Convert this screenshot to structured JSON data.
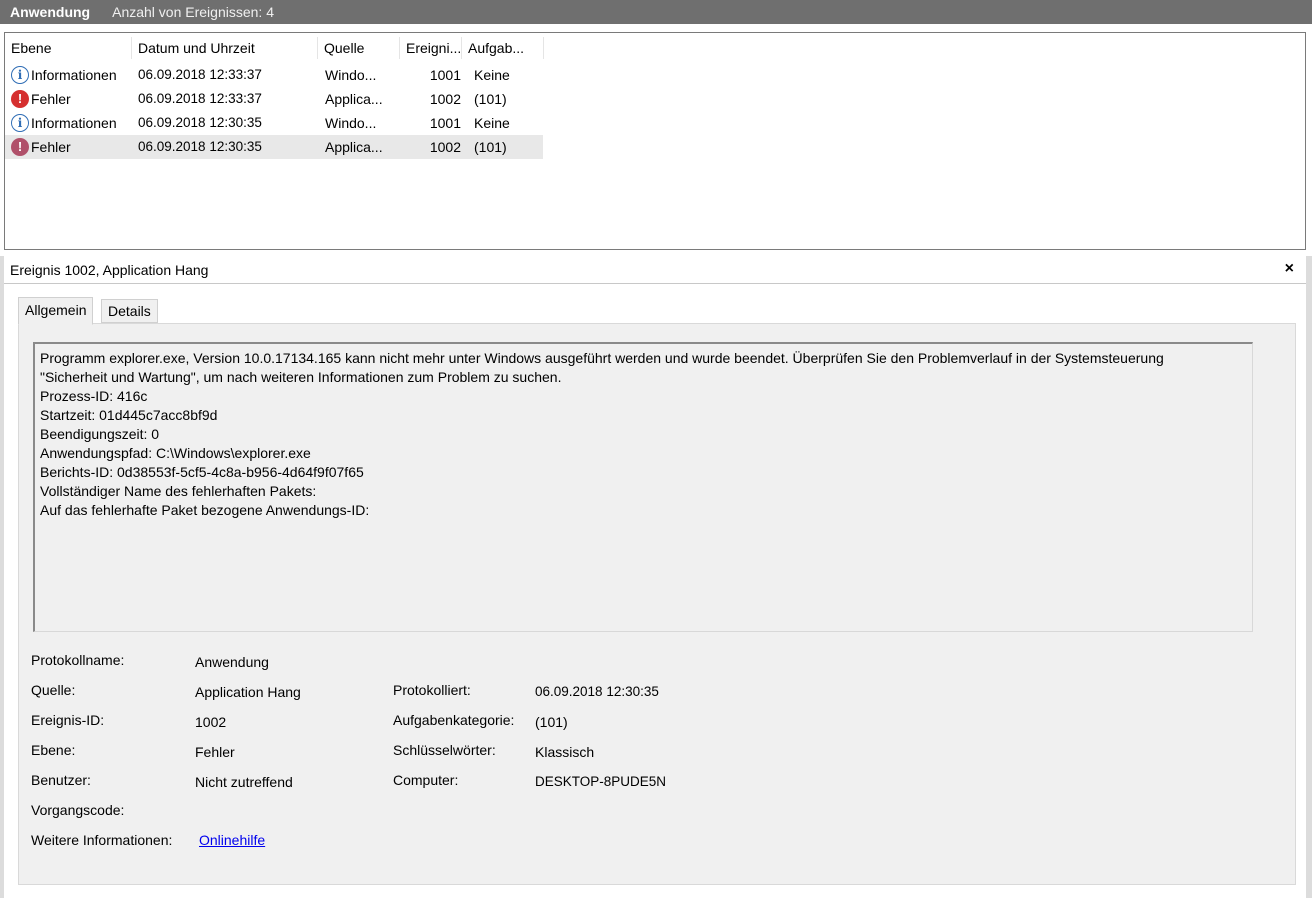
{
  "titlebar": {
    "log_name": "Anwendung",
    "event_count": "Anzahl von Ereignissen: 4"
  },
  "columns": [
    "Ebene",
    "Datum und Uhrzeit",
    "Quelle",
    "Ereigni...",
    "Aufgab..."
  ],
  "events": [
    {
      "icon": "info-icon",
      "level": "Informationen",
      "date": "06.09.2018 12:33:37",
      "source": "Windo...",
      "id": "1001",
      "task": "Keine"
    },
    {
      "icon": "error-icon",
      "level": "Fehler",
      "date": "06.09.2018 12:33:37",
      "source": "Applica...",
      "id": "1002",
      "task": "(101)"
    },
    {
      "icon": "info-icon",
      "level": "Informationen",
      "date": "06.09.2018 12:30:35",
      "source": "Windo...",
      "id": "1001",
      "task": "Keine"
    },
    {
      "icon": "error-icon",
      "level": "Fehler",
      "date": "06.09.2018 12:30:35",
      "source": "Applica...",
      "id": "1002",
      "task": "(101)",
      "selected": true
    }
  ],
  "detail": {
    "title": "Ereignis 1002, Application Hang",
    "close": "×",
    "tabs": [
      "Allgemein",
      "Details"
    ],
    "message": [
      "Programm explorer.exe, Version 10.0.17134.165 kann nicht mehr unter Windows ausgeführt werden und wurde beendet. Überprüfen Sie den Problemverlauf in der Systemsteuerung",
      "\"Sicherheit und Wartung\", um nach weiteren Informationen zum Problem zu suchen.",
      "Prozess-ID: 416c",
      "Startzeit: 01d445c7acc8bf9d",
      "Beendigungszeit: 0",
      "Anwendungspfad: C:\\Windows\\explorer.exe",
      "Berichts-ID: 0d38553f-5cf5-4c8a-b956-4d64f9f07f65",
      "Vollständiger Name des fehlerhaften Pakets:",
      "Auf das fehlerhafte Paket bezogene Anwendungs-ID:"
    ],
    "fields": {
      "protokollname_label": "Protokollname:",
      "protokollname_value": "Anwendung",
      "quelle_label": "Quelle:",
      "quelle_value": "Application Hang",
      "protokolliert_label": "Protokolliert:",
      "protokolliert_value": "06.09.2018 12:30:35",
      "ereignis_id_label": "Ereignis-ID:",
      "ereignis_id_value": "1002",
      "aufgabenkategorie_label": "Aufgabenkategorie:",
      "aufgabenkategorie_value": "(101)",
      "ebene_label": "Ebene:",
      "ebene_value": "Fehler",
      "schluesselwoerter_label": "Schlüsselwörter:",
      "schluesselwoerter_value": "Klassisch",
      "benutzer_label": "Benutzer:",
      "benutzer_value": "Nicht zutreffend",
      "computer_label": "Computer:",
      "computer_value": "DESKTOP-8PUDE5N",
      "vorgangscode_label": "Vorgangscode:",
      "weitere_label": "Weitere Informationen:",
      "weitere_link": "Onlinehilfe"
    }
  }
}
